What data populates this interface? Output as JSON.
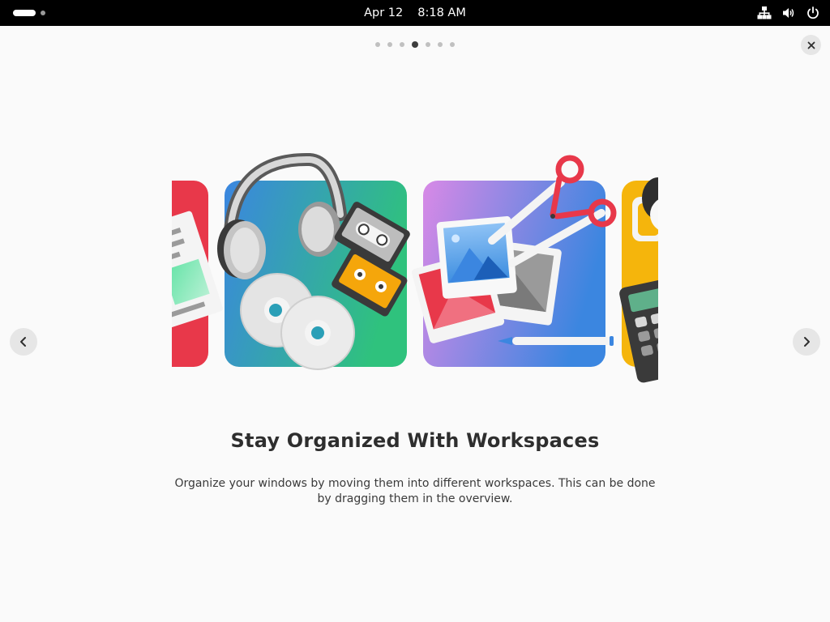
{
  "topbar": {
    "date": "Apr 12",
    "time": "8:18 AM",
    "icons": [
      "activities-indicator",
      "network-wired-icon",
      "volume-icon",
      "power-icon"
    ],
    "bg_color": "#000000"
  },
  "pager": {
    "total": 7,
    "active_index": 3
  },
  "slide": {
    "title": "Stay Organized With Workspaces",
    "description": "Organize your windows by moving them into different workspaces. This can be done by dragging them in the overview."
  },
  "controls": {
    "close_icon": "close-icon",
    "prev_icon": "chevron-left-icon",
    "next_icon": "chevron-right-icon"
  },
  "colors": {
    "accent_red": "#e8384a",
    "accent_blue": "#3b86e0",
    "accent_green": "#2fc27d",
    "accent_purple": "#d889e6",
    "accent_yellow": "#f5b50c"
  }
}
